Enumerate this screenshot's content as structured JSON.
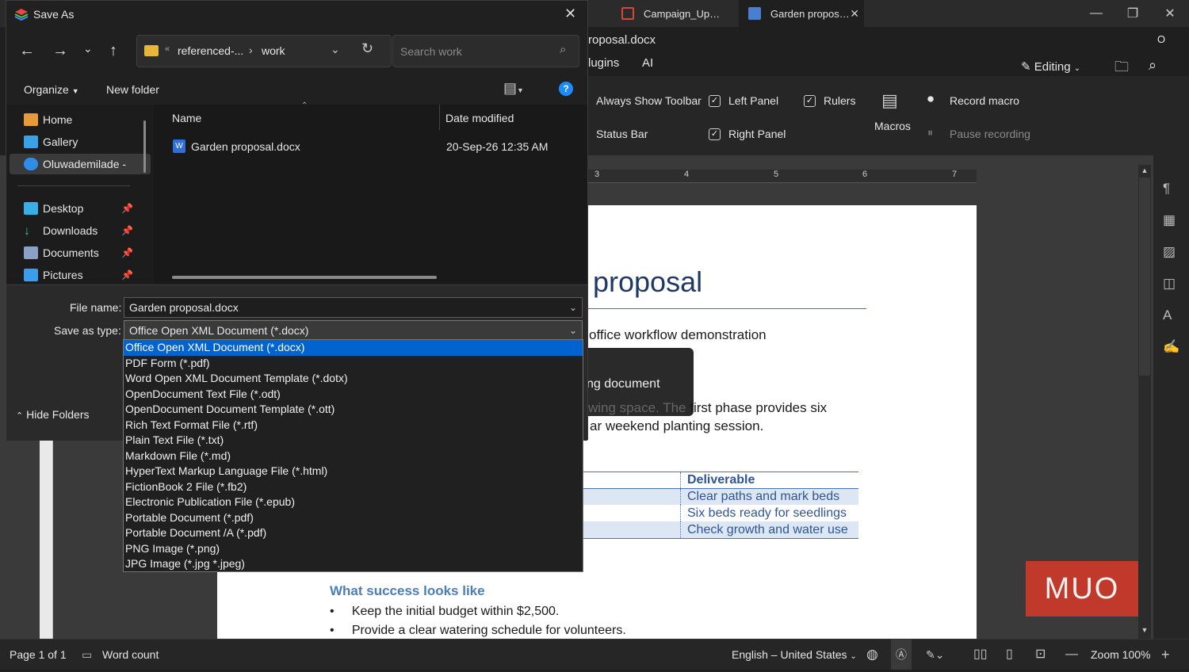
{
  "app": {
    "tabs": [
      {
        "label": "Campaign_Up…",
        "color": "#d04a3a"
      },
      {
        "label": "Garden propos…",
        "color": "#4a7fd0"
      }
    ],
    "doc_name": "roposal.docx",
    "profile_initial": "O",
    "menu": {
      "plugins": "lugins",
      "ai": "AI"
    },
    "editing": "Editing",
    "ribbon": {
      "always_show_toolbar": "Always Show Toolbar",
      "status_bar": "Status Bar",
      "left_panel": "Left Panel",
      "right_panel": "Right Panel",
      "rulers": "Rulers",
      "macros": "Macros",
      "record_macro": "Record macro",
      "pause_recording": "Pause recording"
    },
    "ruler_numbers": [
      "3",
      "4",
      "5",
      "6",
      "7"
    ],
    "document": {
      "title": "proposal",
      "subtitle": "office workflow demonstration",
      "tooltip": "ng document",
      "para1a": "wing space. The ",
      "para1b": "first phase provides six",
      "para2": "ar weekend planting session.",
      "table_header": "Deliverable",
      "table_rows": [
        "Clear paths and mark beds",
        "Six beds ready for seedlings",
        "Check growth and water use"
      ],
      "section_heading": "What success looks like",
      "bullets": [
        "Keep the initial budget within $2,500.",
        "Provide a clear watering schedule for volunteers."
      ]
    },
    "status": {
      "page": "Page 1 of 1",
      "word_count": "Word count",
      "language": "English – United States",
      "zoom": "Zoom 100%"
    },
    "watermark": "MUO"
  },
  "dialog": {
    "title": "Save As",
    "breadcrumb": [
      "referenced-...",
      "work"
    ],
    "breadcrumb_prefix": "«",
    "search_placeholder": "Search work",
    "toolbar": {
      "organize": "Organize",
      "new_folder": "New folder"
    },
    "nav": {
      "quick": [
        "Home",
        "Gallery",
        "Oluwademilade -"
      ],
      "pinned": [
        "Desktop",
        "Downloads",
        "Documents",
        "Pictures"
      ]
    },
    "columns": {
      "name": "Name",
      "date": "Date modified"
    },
    "files": [
      {
        "name": "Garden proposal.docx",
        "date": "20-Sep-26 12:35 AM"
      }
    ],
    "file_name_label": "File name:",
    "file_name_value": "Garden proposal.docx",
    "save_type_label": "Save as type:",
    "save_type_value": "Office Open XML Document (*.docx)",
    "hide_folders": "Hide Folders",
    "type_options": [
      "Office Open XML Document (*.docx)",
      "PDF Form (*.pdf)",
      "Word Open XML Document Template (*.dotx)",
      "OpenDocument Text File (*.odt)",
      "OpenDocument Document Template (*.ott)",
      "Rich Text Format File (*.rtf)",
      "Plain Text File (*.txt)",
      "Markdown File (*.md)",
      "HyperText Markup Language File (*.html)",
      "FictionBook 2 File (*.fb2)",
      "Electronic Publication File (*.epub)",
      "Portable Document (*.pdf)",
      "Portable Document /A (*.pdf)",
      "PNG Image (*.png)",
      "JPG Image (*.jpg *.jpeg)"
    ],
    "selected_option_index": 0
  }
}
